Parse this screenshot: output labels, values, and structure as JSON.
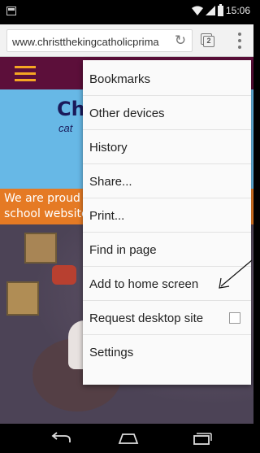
{
  "status_bar": {
    "time": "15:06",
    "icons": [
      "screenshot-icon",
      "wifi-icon",
      "signal-icon",
      "battery-icon"
    ]
  },
  "browser": {
    "url": "www.christthekingcatholicprima",
    "tab_count": "2",
    "icons": [
      "reload-icon",
      "tabs-icon",
      "overflow-menu-icon"
    ]
  },
  "page": {
    "logo_text": "Ch",
    "logo_sub": "cat",
    "banner_text_line1": "We are proud",
    "banner_text_line2": "school website"
  },
  "menu": {
    "items": [
      {
        "label": "Bookmarks"
      },
      {
        "label": "Other devices"
      },
      {
        "label": "History"
      },
      {
        "label": "Share..."
      },
      {
        "label": "Print..."
      },
      {
        "label": "Find in page"
      },
      {
        "label": "Add to home screen"
      },
      {
        "label": "Request desktop site",
        "checked": false
      },
      {
        "label": "Settings"
      }
    ]
  },
  "nav_bar": {
    "icons": [
      "back-icon",
      "home-icon",
      "recents-icon"
    ]
  },
  "colors": {
    "site_header": "#5c0f3a",
    "hamburger": "#f5a623",
    "banner": "#67b8e6",
    "orange_strip": "#e57a24",
    "menu_bg": "#fafafa"
  }
}
